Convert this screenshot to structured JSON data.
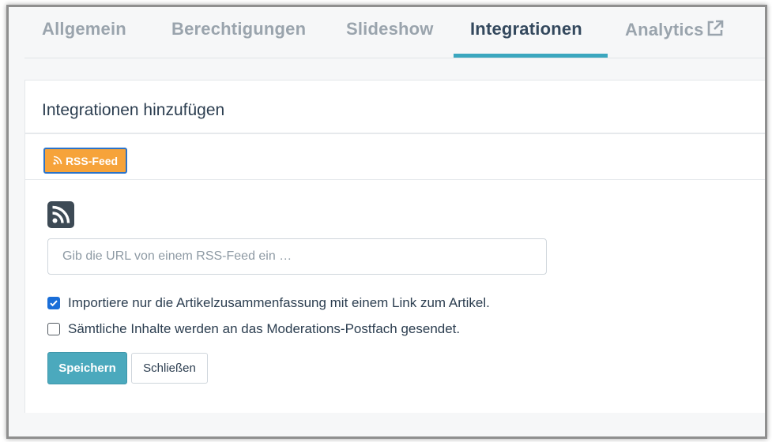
{
  "tabs": [
    {
      "label": "Allgemein",
      "active": false
    },
    {
      "label": "Berechtigungen",
      "active": false
    },
    {
      "label": "Slideshow",
      "active": false
    },
    {
      "label": "Integrationen",
      "active": true
    },
    {
      "label": "Analytics",
      "active": false,
      "icon": "external-link-icon"
    }
  ],
  "panel": {
    "title": "Integrationen hinzufügen",
    "rss_button_label": "RSS-Feed",
    "rss_button_icon": "rss-icon",
    "big_icon": "rss-square-icon"
  },
  "form": {
    "url_placeholder": "Gib die URL von einem RSS-Feed ein …",
    "url_value": "",
    "summary_only_label": "Importiere nur die Artikelzusammenfassung mit einem Link zum Artikel.",
    "summary_only_checked": true,
    "moderation_label": "Sämtliche Inhalte werden an das Moderations-Postfach gesendet.",
    "moderation_checked": false,
    "save_label": "Speichern",
    "close_label": "Schließen"
  },
  "colors": {
    "accent": "#3ba7bf",
    "rss_orange": "#f6a33a",
    "text_dark": "#2c3e50",
    "tab_inactive": "#9aa4ad",
    "checkbox_blue": "#1a6ed8"
  }
}
